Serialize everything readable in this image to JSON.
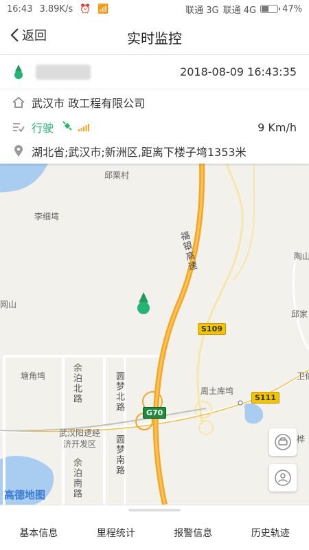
{
  "status_bar": {
    "time": "16:43",
    "net_speed": "3.89K/s",
    "carrier1": "联通 3G",
    "carrier2": "联通 4G",
    "battery": "47%",
    "battery_level": 0.47
  },
  "header": {
    "back_label": "返回",
    "title": "实时监控"
  },
  "vehicle": {
    "datetime": "2018-08-09 16:43:35",
    "company": "武汉市         政工程有限公司",
    "status": "行驶",
    "speed": "9 Km/h",
    "address": "湖北省;武汉市;新洲区,距离下楼子塆1353米"
  },
  "map": {
    "labels": {
      "qiulicun": "邱栗村",
      "lixiwan": "李细塆",
      "wangshan": "网山",
      "taoshan": "陶山",
      "qiujia": "邱家",
      "tangjiaowan": "塘角塆",
      "zhoutukuwan": "周土库塆",
      "devzone": "武汉阳逻经\n济开发区",
      "yubei": "余泊北路",
      "yunan": "余泊南路",
      "yuanmengbei": "圆梦北路",
      "yuanmengnan": "圆梦南路",
      "fuyin": "福银高速",
      "weijia": "卫伯",
      "hua": "桦"
    },
    "shields": {
      "s109": "S109",
      "s111": "S111",
      "g70": "G70"
    },
    "logo": "高德地图",
    "colors": {
      "expressway": "#f5a623",
      "marker": "#22b573",
      "accent": "#22b573"
    }
  },
  "tabs": [
    {
      "label": "基本信息"
    },
    {
      "label": "里程统计"
    },
    {
      "label": "报警信息"
    },
    {
      "label": "历史轨迹"
    }
  ]
}
